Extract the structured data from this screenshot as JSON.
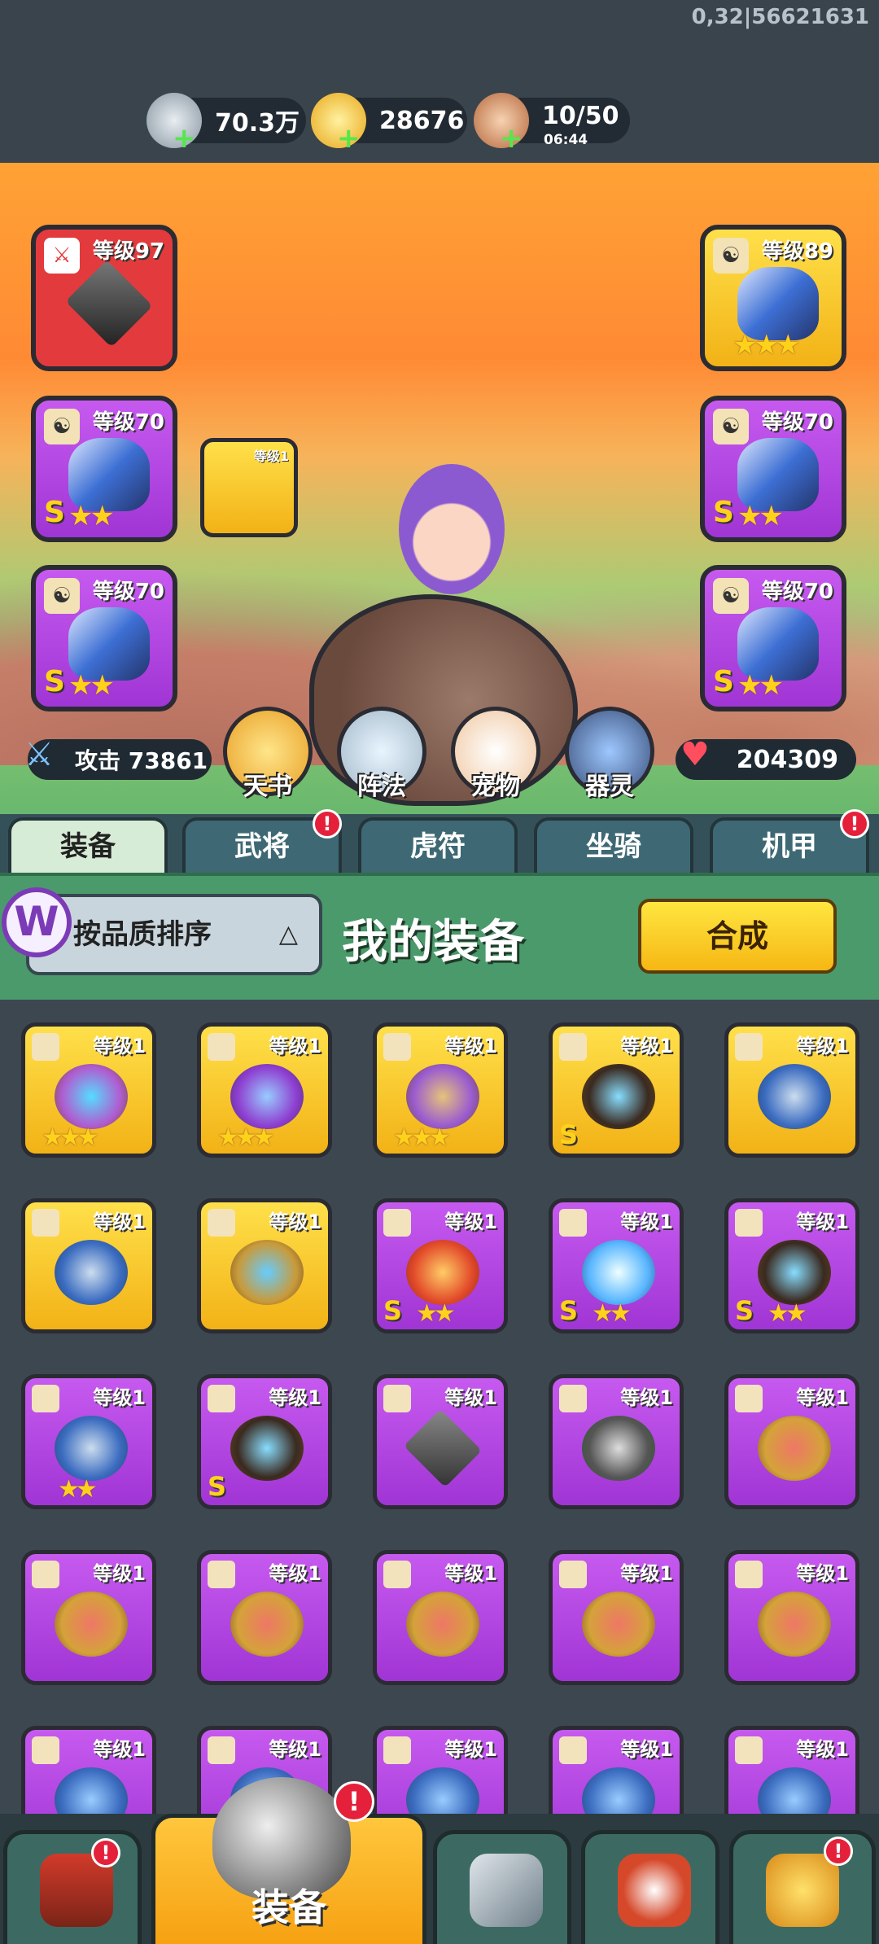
{
  "hud": {
    "coords": "0,32|56621631",
    "silver": "70.3万",
    "gold": "28676",
    "stamina": "10/50",
    "stamina_timer": "06:44",
    "plus": "+"
  },
  "slots": {
    "lvl97": "等级97",
    "lvl89": "等级89",
    "lvl70": "等级70",
    "lvl1": "等级1",
    "grade": "S",
    "stars3": "★★★",
    "stars2": "★★"
  },
  "stats": {
    "attack": "攻击 73861",
    "hp": "204309"
  },
  "skills": [
    "天书",
    "阵法",
    "宠物",
    "器灵"
  ],
  "tabs": [
    "装备",
    "武将",
    "虎符",
    "坐骑",
    "机甲"
  ],
  "panel": {
    "sort": "按品质排序",
    "title": "我的装备",
    "merge": "合成",
    "logo": "W"
  },
  "nav": {
    "active_label": "装备",
    "alert": "!"
  },
  "colors": {
    "purple": "#a035d5",
    "gold": "#f2b216",
    "red": "#e33a3d",
    "green": "#4a9a6b"
  }
}
